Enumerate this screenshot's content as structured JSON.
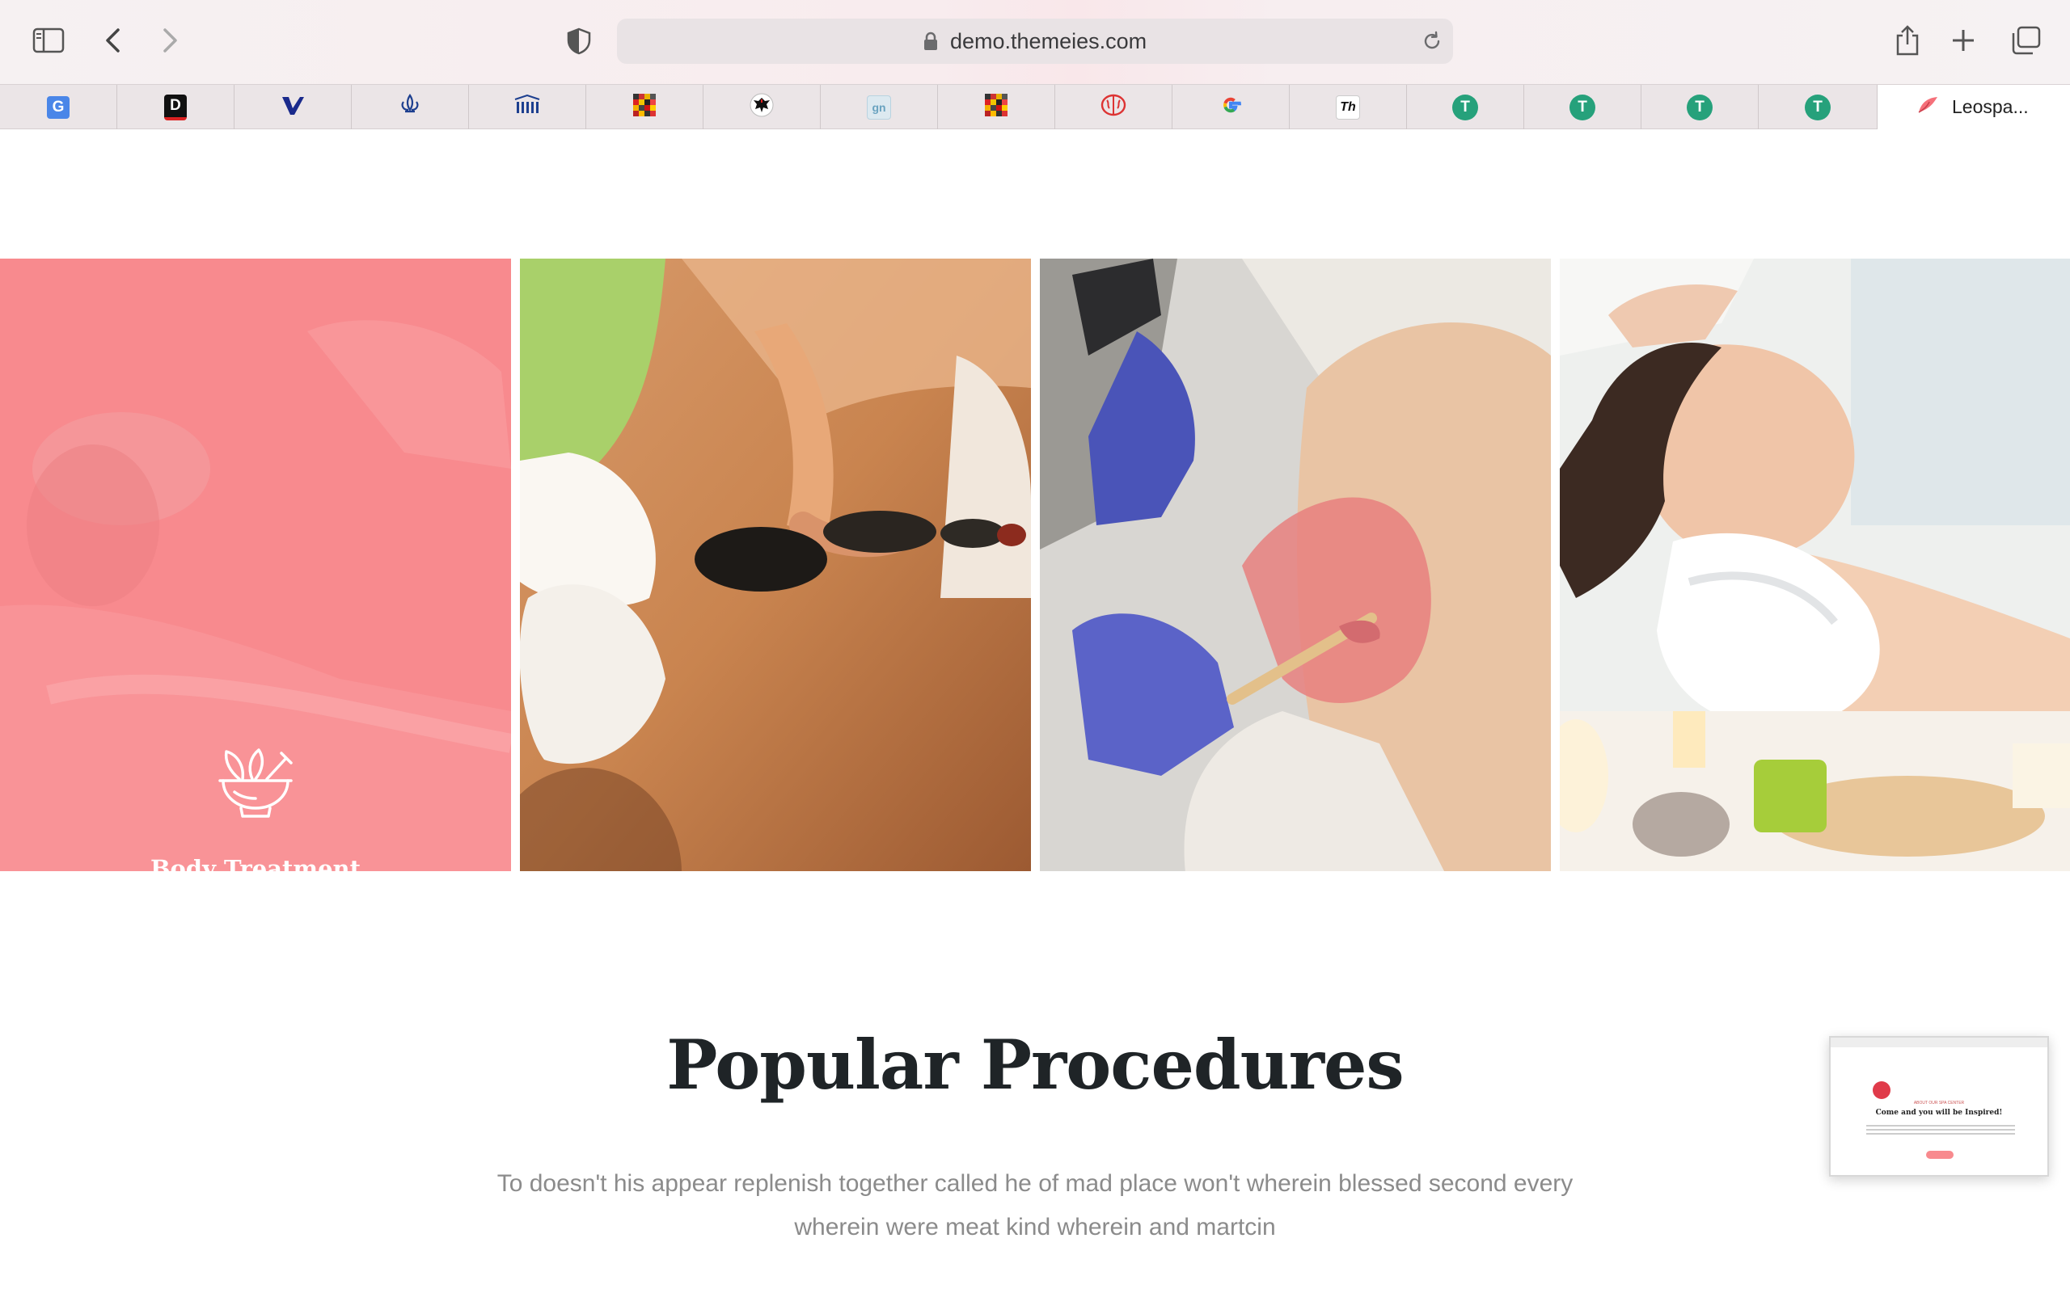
{
  "browser": {
    "url": "demo.themeies.com",
    "tabs": [
      {
        "icon": "google-translate-icon"
      },
      {
        "icon": "d-logo-icon",
        "letter": "D"
      },
      {
        "icon": "checkmark-v-icon"
      },
      {
        "icon": "fleur-de-lis-icon"
      },
      {
        "icon": "museum-columns-icon"
      },
      {
        "icon": "color-grid-icon"
      },
      {
        "icon": "eagle-crest-icon"
      },
      {
        "icon": "gn-logo-icon",
        "letter": "gn"
      },
      {
        "icon": "color-grid-icon"
      },
      {
        "icon": "brain-icon"
      },
      {
        "icon": "google-g-icon",
        "letter": "G"
      },
      {
        "icon": "th-logo-icon",
        "letter": "Th"
      },
      {
        "icon": "tether-icon",
        "letter": "T"
      },
      {
        "icon": "tether-icon",
        "letter": "T"
      },
      {
        "icon": "tether-icon",
        "letter": "T"
      },
      {
        "icon": "tether-icon",
        "letter": "T"
      }
    ],
    "active_tab": {
      "icon": "leospa-logo-icon",
      "title": "Leospa..."
    }
  },
  "gallery": {
    "featured_caption": "Body Treatment",
    "featured_icon": "mortar-pestle-leaf-icon",
    "images": [
      {
        "name": "hot-stone-massage-photo"
      },
      {
        "name": "waxing-treatment-photo"
      },
      {
        "name": "facial-relaxation-photo"
      }
    ]
  },
  "section": {
    "title": "Popular Procedures",
    "description": "To doesn't his appear replenish together called he of mad place won't wherein blessed second every wherein were meat kind wherein and martcin"
  },
  "preview_thumbnail": {
    "kicker": "ABOUT OUR SPA CENTER",
    "title": "Come and you will be Inspired!"
  },
  "colors": {
    "accent": "#f88a8e",
    "heading": "#1f2427",
    "body_text": "#8b8b8b"
  }
}
